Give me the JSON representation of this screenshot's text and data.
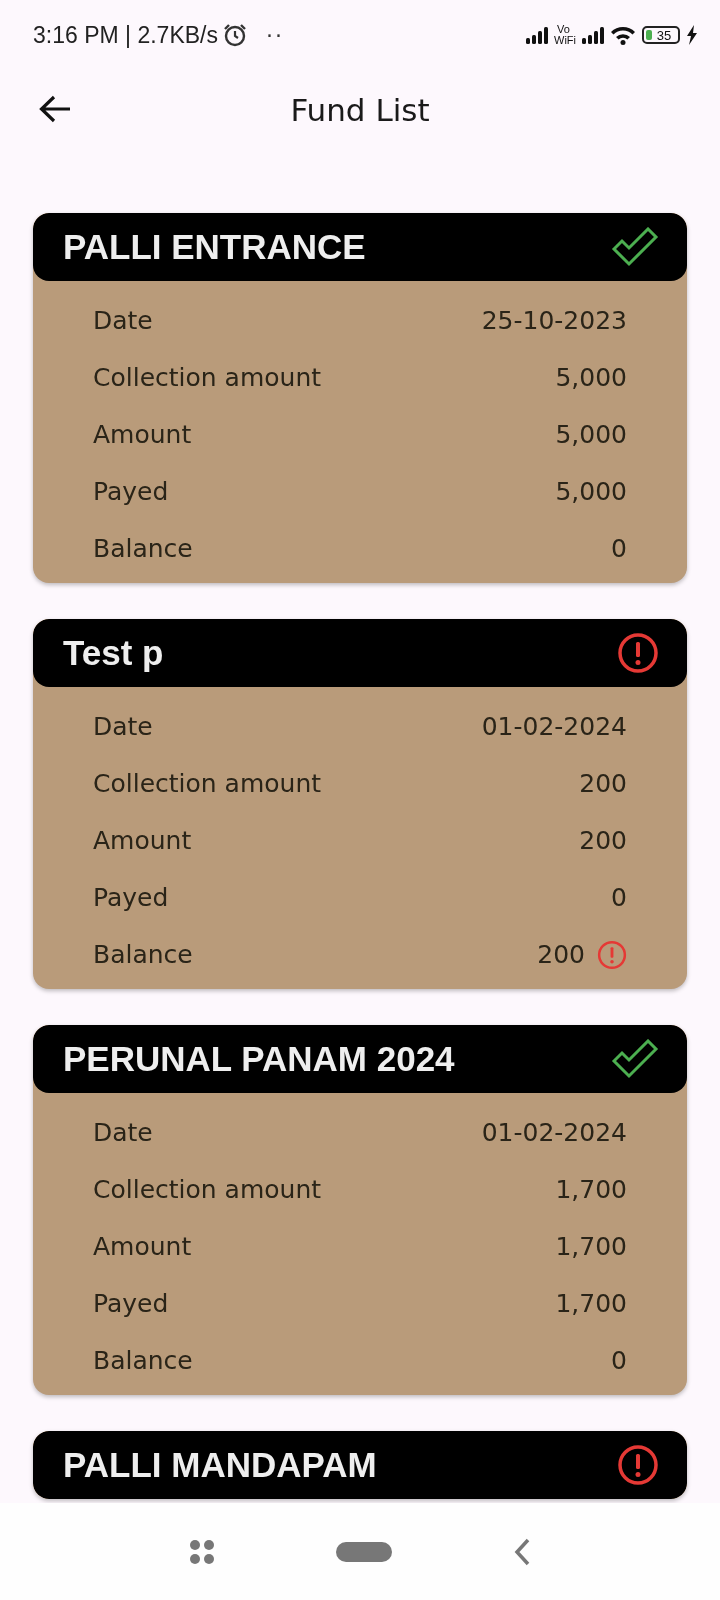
{
  "status_bar": {
    "time": "3:16 PM | 2.7KB/s",
    "dots": "··",
    "vowifi_top": "Vo",
    "vowifi_bottom": "WiFi",
    "battery": "35"
  },
  "app_bar": {
    "title": "Fund List"
  },
  "funds": [
    {
      "name": "PALLI ENTRANCE",
      "settled": true,
      "rows": [
        {
          "label": "Date",
          "value": "25-10-2023",
          "alert": false
        },
        {
          "label": "Collection amount",
          "value": "5,000",
          "alert": false
        },
        {
          "label": "Amount",
          "value": "5,000",
          "alert": false
        },
        {
          "label": "Payed",
          "value": "5,000",
          "alert": false
        },
        {
          "label": "Balance",
          "value": "0",
          "alert": false
        }
      ]
    },
    {
      "name": "Test p",
      "settled": false,
      "rows": [
        {
          "label": "Date",
          "value": "01-02-2024",
          "alert": false
        },
        {
          "label": "Collection amount",
          "value": "200",
          "alert": false
        },
        {
          "label": "Amount",
          "value": "200",
          "alert": false
        },
        {
          "label": "Payed",
          "value": "0",
          "alert": false
        },
        {
          "label": "Balance",
          "value": "200",
          "alert": true
        }
      ]
    },
    {
      "name": "PERUNAL PANAM 2024",
      "settled": true,
      "rows": [
        {
          "label": "Date",
          "value": "01-02-2024",
          "alert": false
        },
        {
          "label": "Collection amount",
          "value": "1,700",
          "alert": false
        },
        {
          "label": "Amount",
          "value": "1,700",
          "alert": false
        },
        {
          "label": "Payed",
          "value": "1,700",
          "alert": false
        },
        {
          "label": "Balance",
          "value": "0",
          "alert": false
        }
      ]
    },
    {
      "name": "PALLI MANDAPAM",
      "settled": false
    }
  ]
}
